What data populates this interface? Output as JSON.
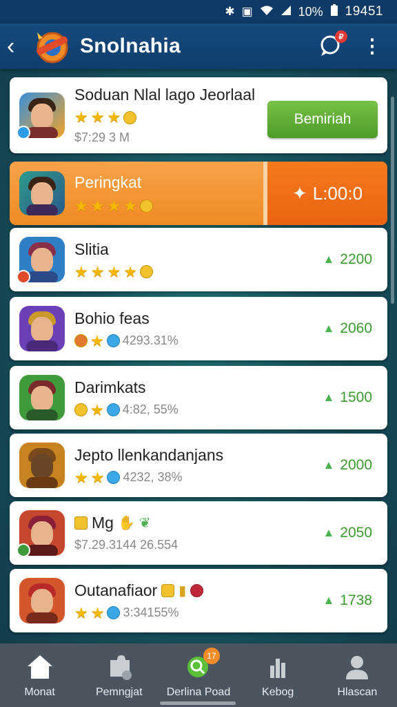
{
  "status_bar": {
    "battery_percent": "10%",
    "time": "19451"
  },
  "app_bar": {
    "title": "Snolnahia",
    "chat_badge": "₽"
  },
  "featured": {
    "name": "Soduan Nlal lago Jeorlaal",
    "price": "$7:29 3 M",
    "button_label": "Bemiriah"
  },
  "highlight": {
    "name": "Peringkat",
    "score": "L:00:0"
  },
  "rows": [
    {
      "name": "Slitia",
      "meta": "",
      "score": "2200",
      "avatar_color": "#2f7fc4"
    },
    {
      "name": "Bohio feas",
      "meta": "4293.31%",
      "score": "2060",
      "avatar_color": "#6b3fb5"
    },
    {
      "name": "Darimkats",
      "meta": "4:82, 55%",
      "score": "1500",
      "avatar_color": "#3e9a3a"
    },
    {
      "name": "Jepto llenkandanjans",
      "meta": "4232, 38%",
      "score": "2000",
      "avatar_color": "#c7831f"
    },
    {
      "name": "Mg",
      "meta": "$7.29.3144 26.554",
      "score": "2050",
      "avatar_color": "#c4472e"
    },
    {
      "name": "Outanafiaor",
      "meta": "3:34155%",
      "score": "1738",
      "avatar_color": "#d2572b"
    }
  ],
  "bottom_nav": [
    {
      "label": "Monat",
      "icon": "home-icon"
    },
    {
      "label": "Pemngjat",
      "icon": "puzzle-icon"
    },
    {
      "label": "Derlina Poad",
      "icon": "search-badge-icon",
      "badge": "17"
    },
    {
      "label": "Kebog",
      "icon": "chart-icon"
    },
    {
      "label": "Hlascan",
      "icon": "profile-icon"
    }
  ],
  "colors": {
    "appbar": "#0f3d6c",
    "accent_green": "#4f9b2a",
    "highlight_orange": "#f08a24",
    "score_green": "#3b9a2f"
  }
}
